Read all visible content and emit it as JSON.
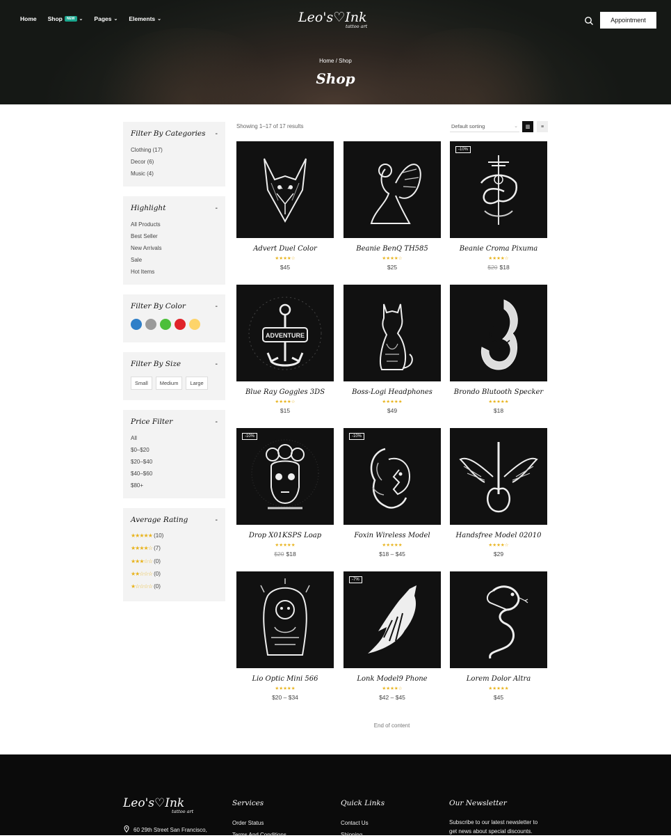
{
  "header": {
    "nav": [
      {
        "label": "Home",
        "dropdown": false
      },
      {
        "label": "Shop",
        "badge": "NEW",
        "dropdown": true
      },
      {
        "label": "Pages",
        "dropdown": true
      },
      {
        "label": "Elements",
        "dropdown": true
      }
    ],
    "logo_main": "Leo's♡Ink",
    "logo_sub": "tattoo art",
    "appointment_label": "Appointment",
    "breadcrumb": "Home / Shop",
    "page_title": "Shop"
  },
  "sidebar": {
    "categories": {
      "title": "Filter By Categories",
      "items": [
        "Clothing (17)",
        "Decor (6)",
        "Music (4)"
      ]
    },
    "highlight": {
      "title": "Highlight",
      "items": [
        "All Products",
        "Best Seller",
        "New Arrivals",
        "Sale",
        "Hot Items"
      ]
    },
    "color": {
      "title": "Filter By Color",
      "swatches": [
        "#2f7fc8",
        "#9a9a9a",
        "#4cbf3a",
        "#e0242a",
        "#fdd46a"
      ]
    },
    "size": {
      "title": "Filter By Size",
      "items": [
        "Small",
        "Medium",
        "Large"
      ]
    },
    "price": {
      "title": "Price Filter",
      "items": [
        "All",
        "$0–$20",
        "$20–$40",
        "$40–$60",
        "$80+"
      ]
    },
    "rating": {
      "title": "Average Rating",
      "items": [
        {
          "stars": "★★★★★",
          "count": "(10)"
        },
        {
          "stars": "★★★★☆",
          "count": "(7)"
        },
        {
          "stars": "★★★☆☆",
          "count": "(0)"
        },
        {
          "stars": "★★☆☆☆",
          "count": "(0)"
        },
        {
          "stars": "★☆☆☆☆",
          "count": "(0)"
        }
      ]
    },
    "toggle": "-"
  },
  "toolbar": {
    "results": "Showing 1–17 of 17 results",
    "sort": "Default sorting",
    "sort_icon": "chevron-down-icon",
    "grid_icon": "grid-view-icon",
    "list_icon": "list-view-icon"
  },
  "products": [
    {
      "name": "Advert Duel Color",
      "stars": "★★★★☆",
      "old_price": "",
      "price": "$45",
      "sale": "",
      "art": "wolf"
    },
    {
      "name": "Beanie BenQ TH585",
      "stars": "★★★★☆",
      "old_price": "",
      "price": "$25",
      "sale": "",
      "art": "angel"
    },
    {
      "name": "Beanie Croma Pixuma",
      "stars": "★★★★☆",
      "old_price": "$20",
      "price": "$18",
      "sale": "-10%",
      "art": "dragon"
    },
    {
      "name": "Blue Ray Goggles 3DS",
      "stars": "★★★★☆",
      "old_price": "",
      "price": "$15",
      "sale": "",
      "art": "anchor"
    },
    {
      "name": "Boss-Logi Headphones",
      "stars": "★★★★★",
      "old_price": "",
      "price": "$49",
      "sale": "",
      "art": "cat"
    },
    {
      "name": "Brondo Blutooth Specker",
      "stars": "★★★★★",
      "old_price": "",
      "price": "$18",
      "sale": "",
      "art": "hook"
    },
    {
      "name": "Drop X01KSPS Loap",
      "stars": "★★★★★",
      "old_price": "$20",
      "price": "$18",
      "sale": "-10%",
      "art": "skull"
    },
    {
      "name": "Foxin Wireless Model",
      "stars": "★★★★★",
      "old_price": "",
      "price": "$18 – $45",
      "sale": "-10%",
      "art": "woman"
    },
    {
      "name": "Handsfree Model 02010",
      "stars": "★★★★☆",
      "old_price": "",
      "price": "$29",
      "sale": "",
      "art": "guitar"
    },
    {
      "name": "Lio Optic Mini 566",
      "stars": "★★★★★",
      "old_price": "",
      "price": "$20 – $34",
      "sale": "",
      "art": "girl"
    },
    {
      "name": "Lonk Model9 Phone",
      "stars": "★★★★☆",
      "old_price": "",
      "price": "$42 – $45",
      "sale": "-7%",
      "art": "wolfhowl"
    },
    {
      "name": "Lorem Dolor Altra",
      "stars": "★★★★★",
      "old_price": "",
      "price": "$45",
      "sale": "",
      "art": "snake"
    }
  ],
  "end_text": "End of content",
  "footer": {
    "logo_main": "Leo's♡Ink",
    "logo_sub": "tattoo art",
    "address": "60 29th Street San Francisco,",
    "services_title": "Services",
    "services": [
      "Order Status",
      "Terms And Conditions"
    ],
    "quick_title": "Quick Links",
    "quick": [
      "Contact Us",
      "Shipping"
    ],
    "newsletter_title": "Our Newsletter",
    "newsletter_text": [
      "Subscribe to our latest newsletter to",
      "get news about special discounts."
    ]
  }
}
